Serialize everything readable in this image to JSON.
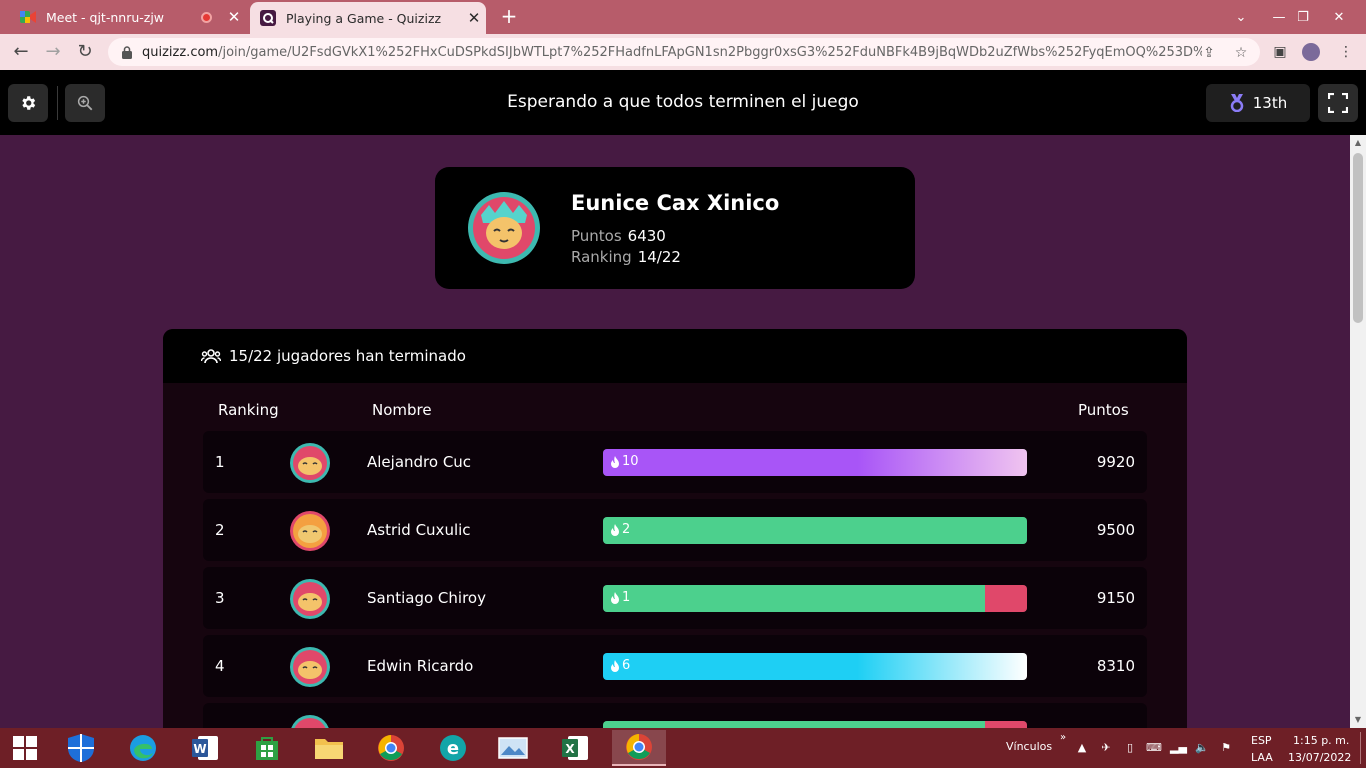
{
  "browser": {
    "tabs": [
      {
        "title": "Meet - qjt-nnru-zjw",
        "active": false
      },
      {
        "title": "Playing a Game - Quizizz",
        "active": true
      }
    ],
    "url_host": "quizizz.com",
    "url_path": "/join/game/U2FsdGVkX1%252FHxCuDSPkdSIJbWTLpt7%252FHadfnLFApGN1sn2Pbggr0xsG3%252FduNBFk4B9jBqWDb2uZfWbs%252FyqEmOQ%253D%253..."
  },
  "quiz": {
    "header_title": "Esperando a que todos terminen el juego",
    "my_rank_badge": "13th"
  },
  "player": {
    "name": "Eunice Cax Xinico",
    "points_label": "Puntos",
    "points": "6430",
    "ranking_label": "Ranking",
    "ranking": "14/22"
  },
  "leaderboard": {
    "finished_text": "15/22 jugadores han terminado",
    "col_ranking": "Ranking",
    "col_name": "Nombre",
    "col_points": "Puntos",
    "rows": [
      {
        "rank": "1",
        "name": "Alejandro Cuc",
        "streak": "10",
        "points": "9920",
        "correct_frac": 1.0,
        "bar_color": "#a855f7",
        "bar_color_end": "#f0c4f0"
      },
      {
        "rank": "2",
        "name": "Astrid Cuxulic",
        "streak": "2",
        "points": "9500",
        "correct_frac": 1.0,
        "bar_color": "#4cd08d",
        "bar_color_end": "#4cd08d"
      },
      {
        "rank": "3",
        "name": "Santiago Chiroy",
        "streak": "1",
        "points": "9150",
        "correct_frac": 0.9,
        "bar_color": "#4cd08d",
        "bar_color_end": "#4cd08d"
      },
      {
        "rank": "4",
        "name": "Edwin Ricardo",
        "streak": "6",
        "points": "8310",
        "correct_frac": 1.0,
        "bar_color": "#1ecff4",
        "bar_color_end": "#ffffff"
      },
      {
        "rank": "",
        "name": "",
        "streak": "",
        "points": "",
        "correct_frac": 0.9,
        "bar_color": "#4cd08d",
        "bar_color_end": "#4cd08d"
      }
    ]
  },
  "taskbar": {
    "links_label": "Vínculos",
    "lang_top": "ESP",
    "lang_bottom": "LAA",
    "time": "1:15 p. m.",
    "date": "13/07/2022"
  }
}
